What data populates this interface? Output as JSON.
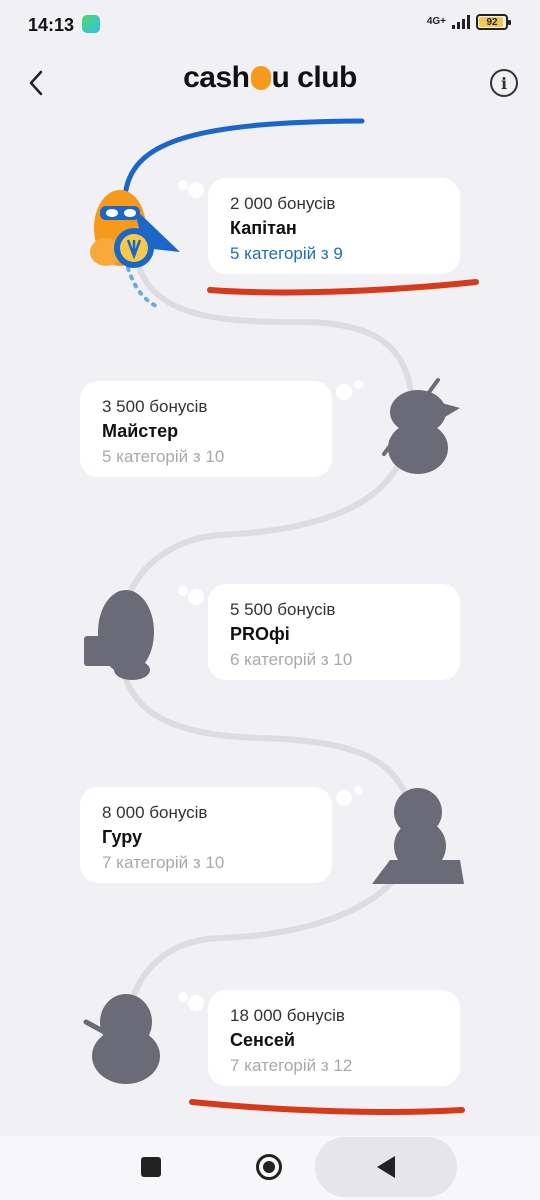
{
  "status_bar": {
    "time": "14:13",
    "network": "4G+",
    "battery": "92"
  },
  "header": {
    "logo_text_left": "cash",
    "logo_text_right": "u club",
    "back_icon": "chevron-left-icon",
    "info_icon": "info-icon",
    "info_glyph": "i"
  },
  "levels": [
    {
      "bonus": "2 000 бонусів",
      "title": "Капітан",
      "progress": "5 категорій з 9",
      "unlocked": true
    },
    {
      "bonus": "3 500 бонусів",
      "title": "Майстер",
      "progress": "5 категорій з 10",
      "unlocked": false
    },
    {
      "bonus": "5 500 бонусів",
      "title": "PROфі",
      "progress": "6 категорій з 10",
      "unlocked": false
    },
    {
      "bonus": "8 000 бонусів",
      "title": "Гуру",
      "progress": "7 категорій з 10",
      "unlocked": false
    },
    {
      "bonus": "18 000 бонусів",
      "title": "Сенсей",
      "progress": "7 категорій з 12",
      "unlocked": false
    }
  ],
  "colors": {
    "accent_blue": "#1d6fb8",
    "mascot_orange": "#f59a1b",
    "locked_silhouette": "#6b6b78",
    "underline_red": "#d63a1a",
    "path_gray": "#dcdce2"
  },
  "nav": {
    "recent_icon": "square-icon",
    "home_icon": "circle-icon",
    "back_icon": "triangle-back-icon"
  }
}
